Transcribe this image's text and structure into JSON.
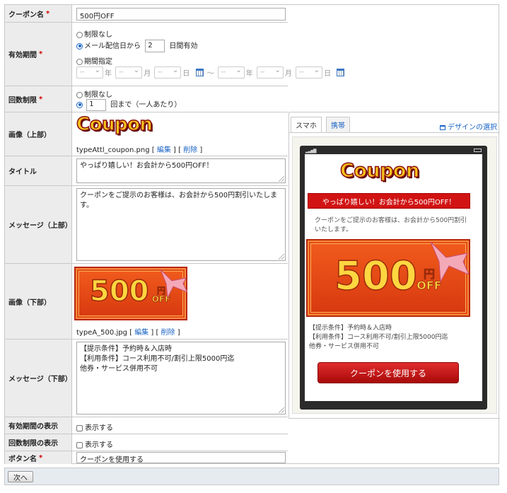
{
  "fields": {
    "coupon_name": {
      "label": "クーポン名",
      "value": "500円OFF"
    },
    "validity": {
      "label": "有効期間",
      "opt_unlimited": "制限なし",
      "opt_days_prefix": "メール配信日から",
      "opt_days_value": "2",
      "opt_days_suffix": "日間有効",
      "opt_period": "期間指定",
      "sel_placeholder": "--",
      "u_year": "年",
      "u_month": "月",
      "u_day": "日",
      "tilde": "～"
    },
    "usage_limit": {
      "label": "回数制限",
      "opt_unlimited": "制限なし",
      "count_value": "1",
      "count_suffix": "回まで（一人あたり）"
    },
    "image_top": {
      "label": "画像（上部）",
      "logo_text": "Coupon",
      "filename": "typeAttl_coupon.png",
      "edit": "編集",
      "delete": "削除"
    },
    "title": {
      "label": "タイトル",
      "value": "やっぱり嬉しい！お会計から500円OFF！"
    },
    "message_top": {
      "label": "メッセージ（上部）",
      "value": "クーポンをご提示のお客様は、お会計から500円割引いたします。"
    },
    "image_bottom": {
      "label": "画像（下部）",
      "big": "500",
      "yen": "円",
      "off": "OFF",
      "filename": "typeA_500.jpg",
      "edit": "編集",
      "delete": "削除"
    },
    "message_bottom": {
      "label": "メッセージ（下部）",
      "value": "【提示条件】予約時＆入店時\n【利用条件】コース利用不可/割引上限5000円迄\n他券・サービス併用不可"
    },
    "show_validity": {
      "label": "有効期間の表示",
      "checkbox": "表示する"
    },
    "show_limit": {
      "label": "回数制限の表示",
      "checkbox": "表示する"
    },
    "button_name": {
      "label": "ボタン名",
      "value": "クーポンを使用する"
    }
  },
  "required_mark": "*",
  "preview": {
    "tab_smartphone": "スマホ",
    "tab_mobile": "携帯",
    "design_link": "デザインの選択",
    "logo_text": "Coupon",
    "title": "やっぱり嬉しい！お会計から500円OFF！",
    "message": "クーポンをご提示のお客様は、お会計から500円割引いたします。",
    "big": "500",
    "yen": "円",
    "off": "OFF",
    "conditions": "【提示条件】予約時＆入店時\n【利用条件】コース利用不可/割引上限5000円迄\n他券・サービス併用不可",
    "button": "クーポンを使用する"
  },
  "next_button": "次へ",
  "colors": {
    "required": "#d00000",
    "link": "#1a63c4",
    "preview_red": "#d11313"
  }
}
